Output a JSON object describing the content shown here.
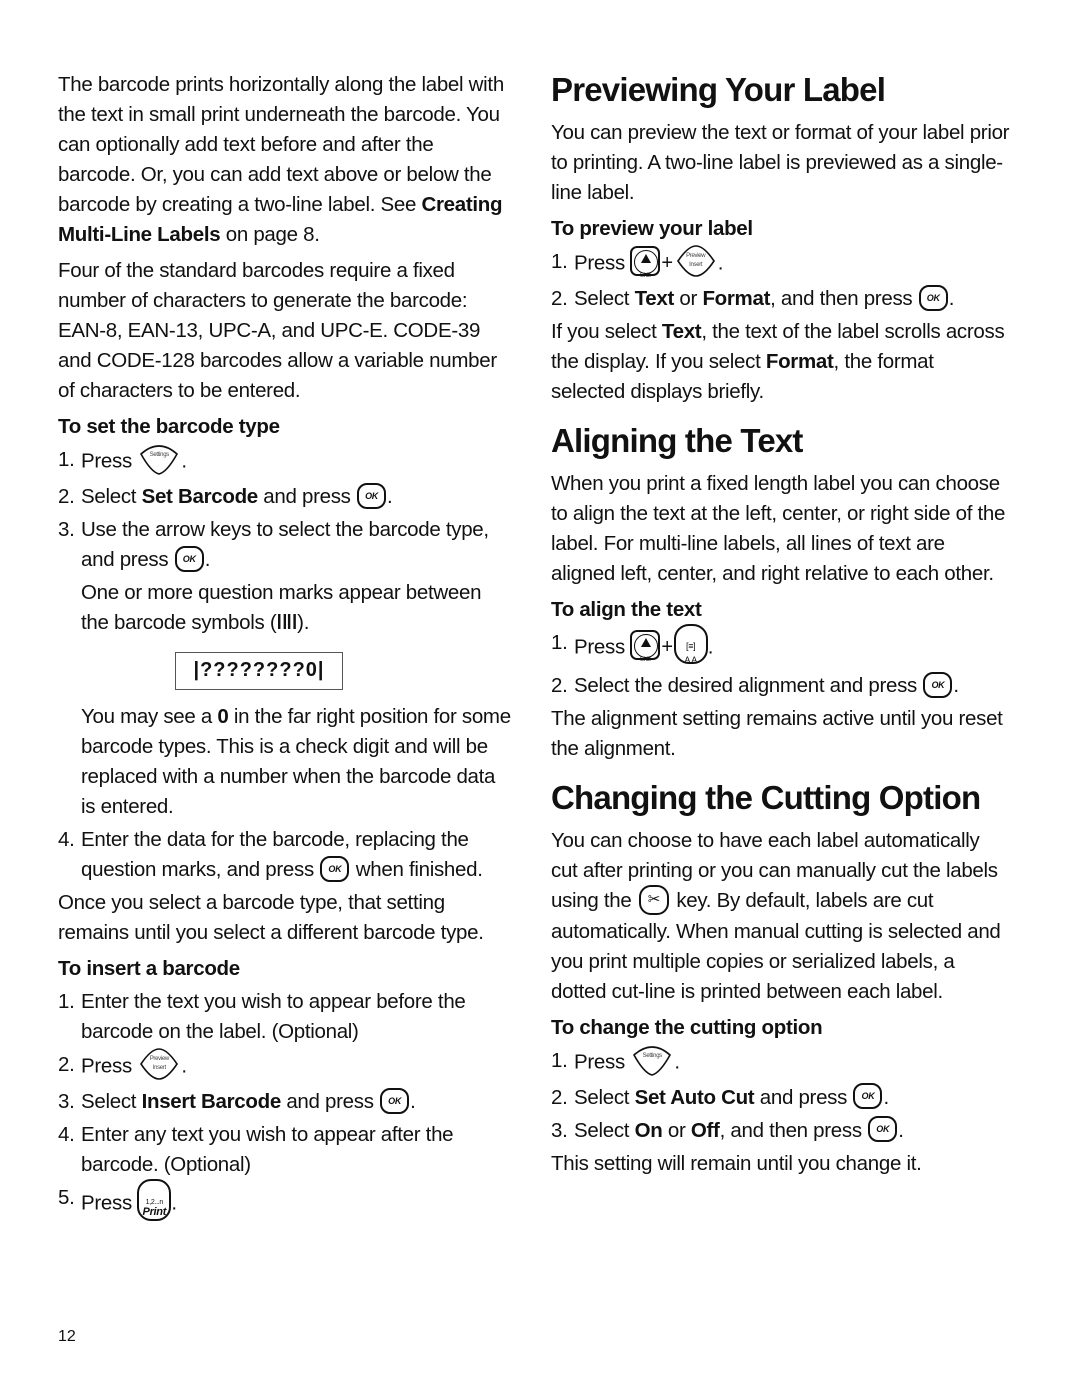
{
  "left": {
    "intro_p1": {
      "text": "The barcode prints horizontally along the label with the text in small print underneath the barcode. You can optionally add text before and after the barcode. Or, you can add text above or below the barcode by creating a two-line label. See ",
      "bold": "Creating Multi-Line Labels",
      "after": " on page 8."
    },
    "intro_p2": "Four of the standard barcodes require a fixed number of characters to generate the barcode: EAN-8, EAN-13, UPC-A, and UPC-E. CODE-39 and CODE-128 barcodes allow a variable number of characters to be entered.",
    "set_type": {
      "heading": "To set the barcode type",
      "step1": {
        "num": "1.",
        "text": "Press",
        "key": "Settings",
        "end": "."
      },
      "step2": {
        "num": "2.",
        "pre": "Select ",
        "bold": "Set Barcode",
        "post": " and press",
        "key": "OK",
        "end": "."
      },
      "step3": {
        "num": "3.",
        "text": "Use the arrow keys to select the barcode type, and press",
        "key": "OK",
        "end": "."
      },
      "note1": "One or more question marks appear between the barcode symbols (",
      "note1_sym": "ǀǁǀ",
      "note1_end": ").",
      "barcode_display": "|????????0|",
      "note2_pre": "You may see a ",
      "note2_bold": "0",
      "note2_post": " in the far right position for some barcode types. This is a check digit and will be replaced with a number when the barcode data is entered.",
      "step4": {
        "num": "4.",
        "text": "Enter the data for the barcode, replacing the question marks, and press",
        "key": "OK",
        "post": " when finished."
      }
    },
    "after_p": "Once you select a barcode type, that setting remains until you select a different barcode type.",
    "insert": {
      "heading": "To insert a barcode",
      "step1": {
        "num": "1.",
        "text": "Enter the text you wish to appear before the barcode on the label. (Optional)"
      },
      "step2": {
        "num": "2.",
        "text": "Press",
        "key_top": "Preview",
        "key_bottom": "Insert",
        "end": "."
      },
      "step3": {
        "num": "3.",
        "pre": "Select ",
        "bold": "Insert Barcode",
        "post": " and press",
        "key": "OK",
        "end": "."
      },
      "step4": {
        "num": "4.",
        "text": "Enter any text you wish to appear after the barcode. (Optional)"
      },
      "step5": {
        "num": "5.",
        "text": "Press",
        "key_top": "1,2...n",
        "key_bottom": "Print",
        "end": "."
      }
    }
  },
  "right": {
    "preview": {
      "title": "Previewing Your Label",
      "intro": "You can preview the text or format of your label prior to printing. A two-line label is previewed as a single-line label.",
      "heading": "To preview your label",
      "step1": {
        "num": "1.",
        "text": "Press",
        "key1": "Shift",
        "plus": "+",
        "key2_top": "Preview",
        "key2_bottom": "Insert",
        "end": "."
      },
      "step2": {
        "num": "2.",
        "pre": "Select ",
        "bold1": "Text",
        "mid": " or ",
        "bold2": "Format",
        "post": ", and then press",
        "key": "OK",
        "end": "."
      },
      "after": {
        "pre": "If you select ",
        "bold1": "Text",
        "mid": ", the text of the label scrolls across the display. If you select ",
        "bold2": "Format",
        "post": ", the format selected displays briefly."
      }
    },
    "align": {
      "title": "Aligning the Text",
      "intro": "When you print a fixed length label you can choose to align the text at the left, center, or right side of the label. For multi-line labels, all lines of text are aligned left, center, and right relative to each other.",
      "heading": "To align the text",
      "step1": {
        "num": "1.",
        "text": "Press",
        "key1": "Shift",
        "plus": "+",
        "key2_top": "[≡]",
        "key2_bottom": "A A",
        "end": "."
      },
      "step2": {
        "num": "2.",
        "text": "Select the desired alignment and press",
        "key": "OK",
        "end": "."
      },
      "after": "The alignment setting remains active until you reset the alignment."
    },
    "cutting": {
      "title": "Changing the Cutting Option",
      "intro_pre": "You can choose to have each label automatically cut after printing or you can manually cut the labels using the",
      "intro_key": "✂",
      "intro_post": "key. By default, labels are cut automatically. When manual cutting is selected and you print multiple copies or serialized labels, a dotted cut-line is printed between each label.",
      "heading": "To change the cutting option",
      "step1": {
        "num": "1.",
        "text": "Press",
        "key": "Settings",
        "end": "."
      },
      "step2": {
        "num": "2.",
        "pre": "Select ",
        "bold": "Set Auto Cut",
        "post": " and press",
        "key": "OK",
        "end": "."
      },
      "step3": {
        "num": "3.",
        "pre": "Select ",
        "bold1": "On",
        "mid": " or ",
        "bold2": "Off",
        "post": ", and then press",
        "key": "OK",
        "end": "."
      },
      "after": "This setting will remain until you change it."
    }
  },
  "footer": {
    "page_number": "12"
  }
}
